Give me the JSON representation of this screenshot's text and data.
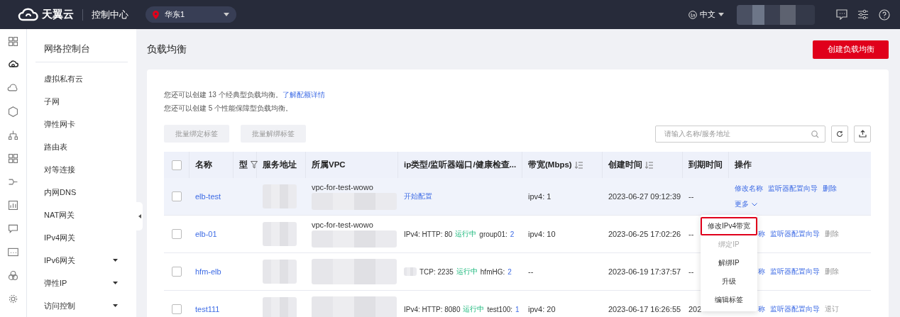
{
  "top_bar": {
    "logo_text": "天翼云",
    "console": "控制中心",
    "region": "华东1",
    "language": "中文",
    "user_blurred": true
  },
  "rail_icons": [
    {
      "selected": false
    },
    {
      "selected": true
    },
    {
      "selected": false
    },
    {
      "selected": false
    },
    {
      "selected": false
    },
    {
      "selected": false
    },
    {
      "selected": false
    },
    {
      "selected": false
    },
    {
      "selected": false
    },
    {
      "selected": false
    },
    {
      "selected": false
    },
    {
      "selected": false
    }
  ],
  "sidebar": {
    "title": "网络控制台",
    "items": [
      {
        "label": "虚拟私有云",
        "expandable": false
      },
      {
        "label": "子网",
        "expandable": false
      },
      {
        "label": "弹性网卡",
        "expandable": false
      },
      {
        "label": "路由表",
        "expandable": false
      },
      {
        "label": "对等连接",
        "expandable": false
      },
      {
        "label": "内网DNS",
        "expandable": false
      },
      {
        "label": "NAT网关",
        "expandable": false
      },
      {
        "label": "IPv4网关",
        "expandable": false
      },
      {
        "label": "IPv6网关",
        "expandable": true
      },
      {
        "label": "弹性IP",
        "expandable": true
      },
      {
        "label": "访问控制",
        "expandable": true
      }
    ]
  },
  "page": {
    "title": "负载均衡",
    "create_button": "创建负载均衡"
  },
  "quota": [
    {
      "text": "您还可以创建 13 个经典型负载均衡。",
      "link": "了解配额详情"
    },
    {
      "text": "您还可以创建 5 个性能保障型负载均衡。"
    }
  ],
  "batch_buttons": [
    "批量绑定标签",
    "批量解绑标签"
  ],
  "search": {
    "placeholder": "请输入名称/服务地址"
  },
  "table": {
    "select_all": {
      "checked": false
    },
    "columns": [
      {
        "label": "名称",
        "sortable": false,
        "filter": false
      },
      {
        "label": "型",
        "sortable": false,
        "filter": true
      },
      {
        "label": "服务地址",
        "sortable": false,
        "filter": false
      },
      {
        "label": "所属VPC",
        "sortable": false,
        "filter": false
      },
      {
        "label": "ip类型/监听器端口/健康检查...",
        "sortable": false,
        "filter": false
      },
      {
        "label": "带宽(Mbps)",
        "sortable": true,
        "filter": false
      },
      {
        "label": "创建时间",
        "sortable": true,
        "filter": false
      },
      {
        "label": "到期时间",
        "sortable": false,
        "filter": false
      },
      {
        "label": "操作",
        "sortable": false,
        "filter": false
      }
    ],
    "rows": [
      {
        "hovered": true,
        "checked": false,
        "name": "elb-test",
        "address_blurred": true,
        "vpc": "vpc-for-test-wowo",
        "vpc_blurred": true,
        "listener": {
          "kind": "link",
          "text": "开始配置"
        },
        "bandwidth": "ipv4: 1",
        "created": "2023-06-27 09:12:39",
        "expires": "--",
        "actions": [
          {
            "label": "修改名称",
            "disabled": false
          },
          {
            "label": "监听器配置向导",
            "disabled": false
          },
          {
            "label": "删除",
            "disabled": false
          }
        ],
        "more": "更多"
      },
      {
        "hovered": false,
        "checked": false,
        "name": "elb-01",
        "address_blurred": true,
        "vpc": "vpc-for-test-wowo",
        "vpc_blurred": true,
        "listener": {
          "kind": "status",
          "prefix": "IPv4: HTTP: 80",
          "status": "运行中",
          "group": "group01:",
          "count": "2"
        },
        "bandwidth": "ipv4: 10",
        "created": "2023-06-25 17:02:26",
        "expires": "--",
        "actions": [
          {
            "label": "称",
            "disabled": false
          },
          {
            "label": "监听器配置向导",
            "disabled": false
          },
          {
            "label": "删除",
            "disabled": true
          }
        ]
      },
      {
        "hovered": false,
        "checked": false,
        "name": "hfm-elb",
        "address_blurred": true,
        "vpc_blurred": true,
        "listener": {
          "kind": "status",
          "blurred": true,
          "prefix": "TCP: 2235",
          "status": "运行中",
          "group": "hfmHG:",
          "count": "2"
        },
        "bandwidth": "--",
        "created": "2023-06-19 17:37:57",
        "expires": "--",
        "actions": [
          {
            "label": "称",
            "disabled": false
          },
          {
            "label": "监听器配置向导",
            "disabled": false
          },
          {
            "label": "删除",
            "disabled": true
          }
        ]
      },
      {
        "hovered": false,
        "checked": false,
        "name": "test111",
        "address_blurred": true,
        "vpc_blurred": true,
        "listener": {
          "kind": "status",
          "prefix": "IPv4: HTTP: 8080",
          "status": "运行中",
          "group": "test100:",
          "count": "1"
        },
        "bandwidth": "ipv4: 20",
        "created": "2023-06-17 16:26:55",
        "expires": "202",
        "actions": [
          {
            "label": "称",
            "disabled": false
          },
          {
            "label": "监听器配置向导",
            "disabled": false
          },
          {
            "label": "退订",
            "disabled": true
          }
        ]
      }
    ]
  },
  "more_menu": [
    {
      "label": "修改IPv4带宽",
      "disabled": false,
      "highlighted": true
    },
    {
      "label": "绑定IP",
      "disabled": true,
      "highlighted": false
    },
    {
      "label": "解绑IP",
      "disabled": false,
      "highlighted": false
    },
    {
      "label": "升级",
      "disabled": false,
      "highlighted": false
    },
    {
      "label": "编辑标签",
      "disabled": false,
      "highlighted": false
    }
  ]
}
